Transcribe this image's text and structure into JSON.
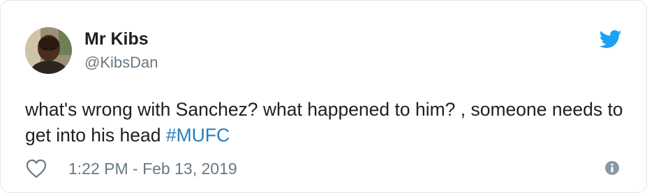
{
  "author": {
    "name": "Mr Kibs",
    "handle": "@KibsDan"
  },
  "tweet": {
    "text": "what's wrong with Sanchez? what happened to him? , someone needs to get into his head ",
    "hashtag": "#MUFC",
    "timestamp": "1:22 PM - Feb 13, 2019"
  },
  "icons": {
    "brand": "twitter-bird-icon",
    "like": "heart-outline-icon",
    "info": "info-circle-icon"
  },
  "colors": {
    "text": "#1c2022",
    "secondary": "#697882",
    "link": "#2b7bb9",
    "twitter_blue": "#1da1f2",
    "border": "#e1e8ed"
  }
}
